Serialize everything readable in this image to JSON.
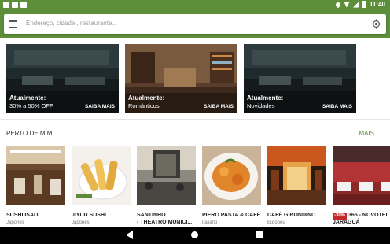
{
  "status_bar": {
    "time": "11:40"
  },
  "search": {
    "placeholder": "Endereço, cidade , restaurante..."
  },
  "promos": [
    {
      "title": "Atualmente:",
      "subtitle": "30% a 50% OFF",
      "action": "SAIBA MAIS"
    },
    {
      "title": "Atualmente:",
      "subtitle": "Românticos",
      "action": "SAIBA MAIS"
    },
    {
      "title": "Atualmente:",
      "subtitle": "Novidades",
      "action": "SAIBA MAIS"
    }
  ],
  "nearby": {
    "title": "PERTO DE MIM",
    "more": "MAIS",
    "restaurants": [
      {
        "name": "SUSHI ISAO",
        "cuisine": "Japonês",
        "badge": ""
      },
      {
        "name": "JIYUU SUSHI",
        "cuisine": "Japonês",
        "badge": ""
      },
      {
        "name": "SANTINHO",
        "name2": "- THEATRO MUNICI...",
        "cuisine": "",
        "badge": ""
      },
      {
        "name": "PIERO PASTA & CAFÉ",
        "cuisine": "Italiano",
        "badge": ""
      },
      {
        "name": "CAFÉ GIRONDINO",
        "cuisine": "Europeu",
        "badge": ""
      },
      {
        "name": "365 - NOVOTEL",
        "name2": "JARAGUÁ",
        "cuisine": "",
        "badge": "-30%"
      }
    ]
  },
  "colors": {
    "brand": "#5d8f3b",
    "badge": "#c62828"
  }
}
